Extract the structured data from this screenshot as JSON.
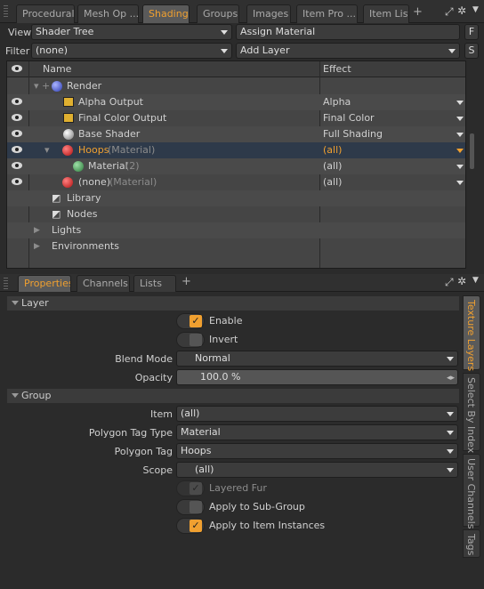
{
  "top_tabs": [
    "Procedural",
    "Mesh Op ...",
    "Shading",
    "Groups",
    "Images",
    "Item Pro ...",
    "Item List"
  ],
  "toolbar": {
    "view_label": "View",
    "view_value": "Shader Tree",
    "assign_material": "Assign Material",
    "f_btn": "F",
    "filter_label": "Filter",
    "filter_value": "(none)",
    "add_layer": "Add Layer",
    "s_btn": "S"
  },
  "tree": {
    "col_name": "Name",
    "col_effect": "Effect",
    "rows": [
      {
        "name": "Render",
        "note": "",
        "effect": ""
      },
      {
        "name": "Alpha Output",
        "note": "",
        "effect": "Alpha"
      },
      {
        "name": "Final Color Output",
        "note": "",
        "effect": "Final Color"
      },
      {
        "name": "Base Shader",
        "note": "",
        "effect": "Full Shading"
      },
      {
        "name": "Hoops",
        "note": "(Material)",
        "effect": "(all)"
      },
      {
        "name": "Material",
        "note": "(2)",
        "effect": "(all)"
      },
      {
        "name": "(none)",
        "note": "(Material)",
        "effect": "(all)"
      },
      {
        "name": "Library",
        "note": "",
        "effect": ""
      },
      {
        "name": "Nodes",
        "note": "",
        "effect": ""
      },
      {
        "name": "Lights",
        "note": "",
        "effect": ""
      },
      {
        "name": "Environments",
        "note": "",
        "effect": ""
      }
    ]
  },
  "bottom_tabs": [
    "Properties",
    "Channels",
    "Lists"
  ],
  "layer": {
    "title": "Layer",
    "enable": "Enable",
    "invert": "Invert",
    "blend_mode_label": "Blend Mode",
    "blend_mode": "Normal",
    "opacity_label": "Opacity",
    "opacity": "100.0 %"
  },
  "group": {
    "title": "Group",
    "item_label": "Item",
    "item": "(all)",
    "ptag_type_label": "Polygon Tag Type",
    "ptag_type": "Material",
    "ptag_label": "Polygon Tag",
    "ptag": "Hoops",
    "scope_label": "Scope",
    "scope": "(all)",
    "layered_fur": "Layered Fur",
    "apply_sub": "Apply to Sub-Group",
    "apply_inst": "Apply to Item Instances"
  },
  "side_tabs": [
    "Texture Layers",
    "Select By Index",
    "User Channels",
    "Tags"
  ],
  "colors": {
    "accent": "#f0a030",
    "selection": "#2e3a4a"
  }
}
